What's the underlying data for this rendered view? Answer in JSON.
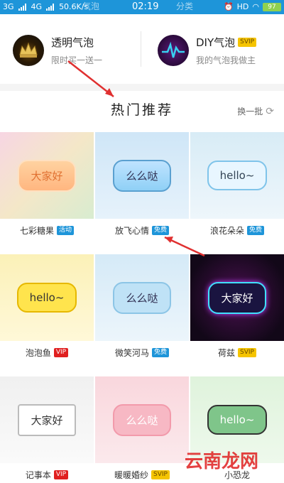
{
  "status_bar": {
    "net1": "3G",
    "net2": "4G",
    "speed": "50.6K/s",
    "time": "02:19",
    "battery": "97",
    "hd": "HD",
    "tab_left_ghost": "气泡",
    "tab_right_ghost": "分类"
  },
  "features": [
    {
      "title": "透明气泡",
      "subtitle": "限时买一送一"
    },
    {
      "title": "DIY气泡",
      "badge": "SVIP",
      "subtitle": "我的气泡我做主"
    }
  ],
  "section": {
    "title": "热门推荐",
    "refresh_label": "换一批"
  },
  "items": [
    {
      "bubble_text": "大家好",
      "name": "七彩糖果",
      "badge": "活动",
      "badge_color": "blue"
    },
    {
      "bubble_text": "么么哒",
      "name": "放飞心情",
      "badge": "免费",
      "badge_color": "blue"
    },
    {
      "bubble_text": "hello~",
      "name": "浪花朵朵",
      "badge": "免费",
      "badge_color": "blue"
    },
    {
      "bubble_text": "hello~",
      "name": "泡泡鱼",
      "badge": "VIP",
      "badge_color": "red"
    },
    {
      "bubble_text": "么么哒",
      "name": "微笑河马",
      "badge": "免费",
      "badge_color": "blue"
    },
    {
      "bubble_text": "大家好",
      "name": "荷兹",
      "badge": "SVIP",
      "badge_color": "gold"
    },
    {
      "bubble_text": "大家好",
      "name": "记事本",
      "badge": "VIP",
      "badge_color": "red"
    },
    {
      "bubble_text": "么么哒",
      "name": "暖暖婚纱",
      "badge": "SVIP",
      "badge_color": "gold"
    },
    {
      "bubble_text": "hello~",
      "name": "小恐龙",
      "badge": "",
      "badge_color": "red"
    }
  ],
  "watermark": "云南龙网",
  "colors": {
    "accent": "#1e95d9",
    "arrow": "#e03030"
  }
}
